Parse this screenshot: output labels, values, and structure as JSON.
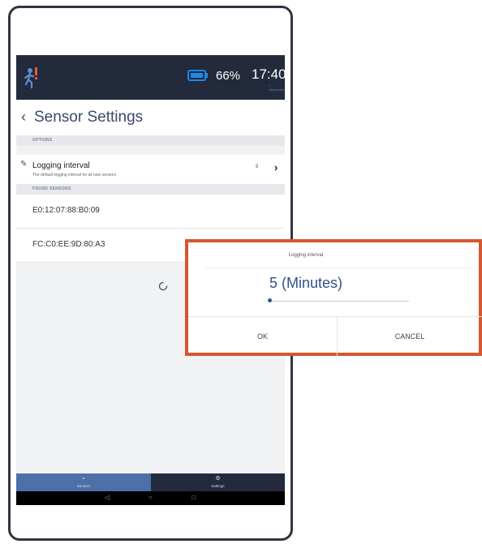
{
  "status_bar": {
    "battery_percent": "66%",
    "time": "17:40",
    "time_subtext": "7 September",
    "battery_fill": 0.66
  },
  "header": {
    "title": "Sensor Settings"
  },
  "options_section": {
    "label": "OPTIONS",
    "logging_interval": {
      "label": "Logging interval",
      "description": "The default logging interval for all new sensors",
      "value": "5"
    }
  },
  "found_sensors_section": {
    "label": "FOUND SENSORS",
    "sensors": [
      "E0:12:07:88:B0:09",
      "FC:C0:EE:9D:80:A3"
    ]
  },
  "bottom_nav": {
    "tabs": [
      {
        "label": "Sensors",
        "icon": "chart-icon",
        "active": true
      },
      {
        "label": "Settings",
        "icon": "gear-icon",
        "active": false
      }
    ]
  },
  "dialog": {
    "title": "Logging interval",
    "value": "5 (Minutes)",
    "slider_level": 0.0,
    "ok_label": "OK",
    "cancel_label": "CANCEL"
  },
  "colors": {
    "status_bar": "#232a3b",
    "accent": "#34508c",
    "highlight_border": "#d7572e",
    "battery": "#1e88e5"
  }
}
